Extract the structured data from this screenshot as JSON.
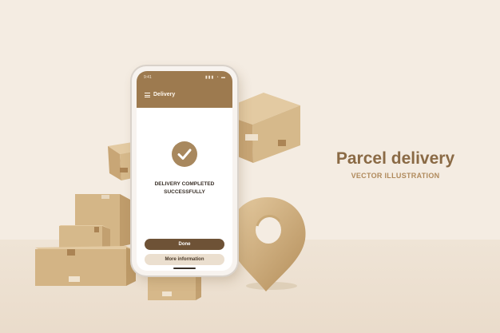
{
  "phone": {
    "status_time": "9:41",
    "status_signal": "▮▮▮ ◔ ▬",
    "app_title": "Delivery",
    "message": "DELIVERY COMPLETED SUCCESSFULLY",
    "done_label": "Done",
    "more_label": "More information",
    "icons": [
      "menu-icon",
      "check-icon"
    ]
  },
  "headline": {
    "title": "Parcel delivery",
    "subtitle": "VECTOR ILLUSTRATION"
  },
  "colors": {
    "background": "#f4ece2",
    "brand_brown": "#9d7a4f",
    "dark_brown": "#6e5236",
    "title_brown": "#8a6a45",
    "cardboard": "#d2b488"
  }
}
